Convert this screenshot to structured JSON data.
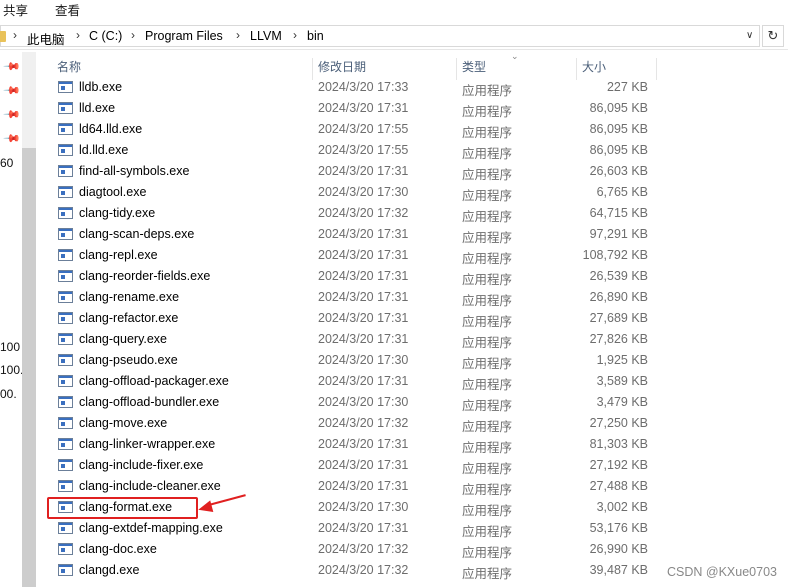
{
  "ribbon": {
    "tabs": [
      "共享",
      "查看"
    ]
  },
  "address": {
    "crumbs": [
      "此电脑",
      "C (C:)",
      "Program Files",
      "LLVM",
      "bin"
    ],
    "refresh_icon": "refresh-icon"
  },
  "nav": {
    "side_texts": [
      "60",
      "100",
      "100.",
      "00."
    ]
  },
  "columns": {
    "name": "名称",
    "date": "修改日期",
    "type": "类型",
    "size": "大小"
  },
  "files": [
    {
      "name": "lldb.exe",
      "date": "2024/3/20 17:33",
      "type": "应用程序",
      "size": "227 KB"
    },
    {
      "name": "lld.exe",
      "date": "2024/3/20 17:31",
      "type": "应用程序",
      "size": "86,095 KB"
    },
    {
      "name": "ld64.lld.exe",
      "date": "2024/3/20 17:55",
      "type": "应用程序",
      "size": "86,095 KB"
    },
    {
      "name": "ld.lld.exe",
      "date": "2024/3/20 17:55",
      "type": "应用程序",
      "size": "86,095 KB"
    },
    {
      "name": "find-all-symbols.exe",
      "date": "2024/3/20 17:31",
      "type": "应用程序",
      "size": "26,603 KB"
    },
    {
      "name": "diagtool.exe",
      "date": "2024/3/20 17:30",
      "type": "应用程序",
      "size": "6,765 KB"
    },
    {
      "name": "clang-tidy.exe",
      "date": "2024/3/20 17:32",
      "type": "应用程序",
      "size": "64,715 KB"
    },
    {
      "name": "clang-scan-deps.exe",
      "date": "2024/3/20 17:31",
      "type": "应用程序",
      "size": "97,291 KB"
    },
    {
      "name": "clang-repl.exe",
      "date": "2024/3/20 17:31",
      "type": "应用程序",
      "size": "108,792 KB"
    },
    {
      "name": "clang-reorder-fields.exe",
      "date": "2024/3/20 17:31",
      "type": "应用程序",
      "size": "26,539 KB"
    },
    {
      "name": "clang-rename.exe",
      "date": "2024/3/20 17:31",
      "type": "应用程序",
      "size": "26,890 KB"
    },
    {
      "name": "clang-refactor.exe",
      "date": "2024/3/20 17:31",
      "type": "应用程序",
      "size": "27,689 KB"
    },
    {
      "name": "clang-query.exe",
      "date": "2024/3/20 17:31",
      "type": "应用程序",
      "size": "27,826 KB"
    },
    {
      "name": "clang-pseudo.exe",
      "date": "2024/3/20 17:30",
      "type": "应用程序",
      "size": "1,925 KB"
    },
    {
      "name": "clang-offload-packager.exe",
      "date": "2024/3/20 17:31",
      "type": "应用程序",
      "size": "3,589 KB"
    },
    {
      "name": "clang-offload-bundler.exe",
      "date": "2024/3/20 17:30",
      "type": "应用程序",
      "size": "3,479 KB"
    },
    {
      "name": "clang-move.exe",
      "date": "2024/3/20 17:32",
      "type": "应用程序",
      "size": "27,250 KB"
    },
    {
      "name": "clang-linker-wrapper.exe",
      "date": "2024/3/20 17:31",
      "type": "应用程序",
      "size": "81,303 KB"
    },
    {
      "name": "clang-include-fixer.exe",
      "date": "2024/3/20 17:31",
      "type": "应用程序",
      "size": "27,192 KB"
    },
    {
      "name": "clang-include-cleaner.exe",
      "date": "2024/3/20 17:31",
      "type": "应用程序",
      "size": "27,488 KB"
    },
    {
      "name": "clang-format.exe",
      "date": "2024/3/20 17:30",
      "type": "应用程序",
      "size": "3,002 KB"
    },
    {
      "name": "clang-extdef-mapping.exe",
      "date": "2024/3/20 17:31",
      "type": "应用程序",
      "size": "53,176 KB"
    },
    {
      "name": "clang-doc.exe",
      "date": "2024/3/20 17:32",
      "type": "应用程序",
      "size": "26,990 KB"
    },
    {
      "name": "clangd.exe",
      "date": "2024/3/20 17:32",
      "type": "应用程序",
      "size": "39,487 KB"
    }
  ],
  "annotation": {
    "highlighted_file": "clang-format.exe",
    "color": "#e02020"
  },
  "watermark": "CSDN @KXue0703"
}
